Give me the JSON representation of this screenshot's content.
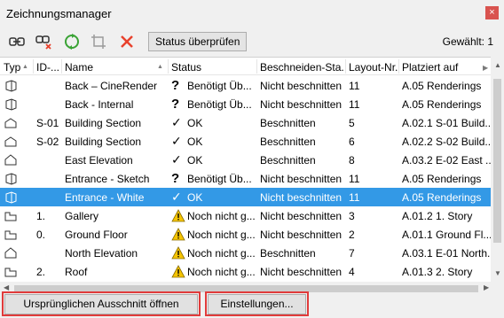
{
  "window": {
    "title": "Zeichnungsmanager",
    "close_symbol": "×"
  },
  "toolbar": {
    "status_button": "Status überprüfen",
    "selected_count": "Gewählt: 1"
  },
  "table": {
    "headers": {
      "type": "Typ",
      "id": "ID-...",
      "name": "Name",
      "status": "Status",
      "crop": "Beschneiden-Sta...",
      "layout": "Layout-Nr.",
      "placed": "Platziert auf"
    },
    "rows": [
      {
        "icon": "view-3d-icon",
        "id": "",
        "name": "Back – CineRender",
        "status_icon": "question-icon",
        "status": "Benötigt Üb...",
        "crop": "Nicht beschnitten",
        "layout": "11",
        "placed": "A.05 Renderings"
      },
      {
        "icon": "view-3d-icon",
        "id": "",
        "name": "Back - Internal",
        "status_icon": "question-icon",
        "status": "Benötigt Üb...",
        "crop": "Nicht beschnitten",
        "layout": "11",
        "placed": "A.05 Renderings"
      },
      {
        "icon": "section-icon",
        "id": "S-01",
        "name": "Building Section",
        "status_icon": "check-icon",
        "status": "OK",
        "crop": "Beschnitten",
        "layout": "5",
        "placed": "A.02.1 S-01 Build..."
      },
      {
        "icon": "section-icon",
        "id": "S-02",
        "name": "Building Section",
        "status_icon": "check-icon",
        "status": "OK",
        "crop": "Beschnitten",
        "layout": "6",
        "placed": "A.02.2 S-02 Build..."
      },
      {
        "icon": "elevation-icon",
        "id": "",
        "name": "East Elevation",
        "status_icon": "check-icon",
        "status": "OK",
        "crop": "Beschnitten",
        "layout": "8",
        "placed": "A.03.2 E-02 East ..."
      },
      {
        "icon": "view-3d-icon",
        "id": "",
        "name": "Entrance - Sketch",
        "status_icon": "question-icon",
        "status": "Benötigt Üb...",
        "crop": "Nicht beschnitten",
        "layout": "11",
        "placed": "A.05 Renderings"
      },
      {
        "icon": "view-3d-icon",
        "id": "",
        "name": "Entrance - White",
        "status_icon": "check-icon",
        "status": "OK",
        "crop": "Nicht beschnitten",
        "layout": "11",
        "placed": "A.05 Renderings",
        "selected": true
      },
      {
        "icon": "floor-plan-icon",
        "id": "1.",
        "name": "Gallery",
        "status_icon": "warning-icon",
        "status": "Noch nicht g...",
        "crop": "Nicht beschnitten",
        "layout": "3",
        "placed": "A.01.2 1. Story"
      },
      {
        "icon": "floor-plan-icon",
        "id": "0.",
        "name": "Ground Floor",
        "status_icon": "warning-icon",
        "status": "Noch nicht g...",
        "crop": "Nicht beschnitten",
        "layout": "2",
        "placed": "A.01.1 Ground Fl..."
      },
      {
        "icon": "elevation-icon",
        "id": "",
        "name": "North Elevation",
        "status_icon": "warning-icon",
        "status": "Noch nicht g...",
        "crop": "Beschnitten",
        "layout": "7",
        "placed": "A.03.1 E-01 North..."
      },
      {
        "icon": "floor-plan-icon",
        "id": "2.",
        "name": "Roof",
        "status_icon": "warning-icon",
        "status": "Noch nicht g...",
        "crop": "Nicht beschnitten",
        "layout": "4",
        "placed": "A.01.3 2. Story"
      }
    ]
  },
  "buttons": {
    "open_original": "Ursprünglichen Ausschnitt öffnen",
    "settings": "Einstellungen..."
  },
  "colors": {
    "selection": "#3399e6",
    "highlight_frame": "#e03b3b",
    "delete": "#e8412c",
    "refresh": "#3aa335",
    "warning": "#f5c400"
  }
}
